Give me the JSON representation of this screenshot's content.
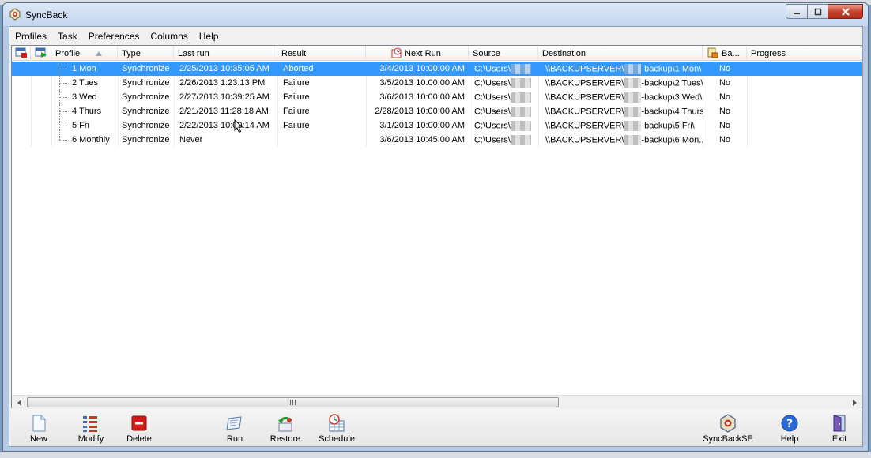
{
  "window": {
    "title": "SyncBack"
  },
  "menu": [
    "Profiles",
    "Task",
    "Preferences",
    "Columns",
    "Help"
  ],
  "columns": {
    "profile": "Profile",
    "type": "Type",
    "last_run": "Last run",
    "result": "Result",
    "next_run": "Next Run",
    "source": "Source",
    "destination": "Destination",
    "backup": "Ba...",
    "progress": "Progress"
  },
  "rows": [
    {
      "profile": "1 Mon",
      "type": "Synchronize",
      "last_run": "2/25/2013 10:35:05 AM",
      "result": "Aborted",
      "next_run": "3/4/2013 10:00:00 AM",
      "source": "C:\\Users\\",
      "dest_prefix": "\\\\BACKUPSERVER\\",
      "dest_suffix": "-backup\\1 Mon\\",
      "backup": "No",
      "selected": true
    },
    {
      "profile": "2 Tues",
      "type": "Synchronize",
      "last_run": "2/26/2013 1:23:13 PM",
      "result": "Failure",
      "next_run": "3/5/2013 10:00:00 AM",
      "source": "C:\\Users\\",
      "dest_prefix": "\\\\BACKUPSERVER\\",
      "dest_suffix": "-backup\\2 Tues\\",
      "backup": "No",
      "selected": false
    },
    {
      "profile": "3 Wed",
      "type": "Synchronize",
      "last_run": "2/27/2013 10:39:25 AM",
      "result": "Failure",
      "next_run": "3/6/2013 10:00:00 AM",
      "source": "C:\\Users\\",
      "dest_prefix": "\\\\BACKUPSERVER\\",
      "dest_suffix": "-backup\\3 Wed\\",
      "backup": "No",
      "selected": false
    },
    {
      "profile": "4 Thurs",
      "type": "Synchronize",
      "last_run": "2/21/2013 11:28:18 AM",
      "result": "Failure",
      "next_run": "2/28/2013 10:00:00 AM",
      "source": "C:\\Users\\",
      "dest_prefix": "\\\\BACKUPSERVER\\",
      "dest_suffix": "-backup\\4 Thurs\\",
      "backup": "No",
      "selected": false
    },
    {
      "profile": "5 Fri",
      "type": "Synchronize",
      "last_run": "2/22/2013 10:09:14 AM",
      "result": "Failure",
      "next_run": "3/1/2013 10:00:00 AM",
      "source": "C:\\Users\\",
      "dest_prefix": "\\\\BACKUPSERVER\\",
      "dest_suffix": "-backup\\5 Fri\\",
      "backup": "No",
      "selected": false
    },
    {
      "profile": "6 Monthly",
      "type": "Synchronize",
      "last_run": "Never",
      "result": "",
      "next_run": "3/6/2013 10:45:00 AM",
      "source": "C:\\Users\\",
      "dest_prefix": "\\\\BACKUPSERVER\\",
      "dest_suffix": "-backup\\6 Mon...",
      "backup": "No",
      "selected": false
    }
  ],
  "toolbar": {
    "new": "New",
    "modify": "Modify",
    "delete": "Delete",
    "run": "Run",
    "restore": "Restore",
    "schedule": "Schedule",
    "syncbackse": "SyncBackSE",
    "help": "Help",
    "exit": "Exit"
  },
  "colors": {
    "selection": "#3399ff",
    "delete_red": "#d21a1a",
    "help_blue": "#2a6ad8"
  }
}
